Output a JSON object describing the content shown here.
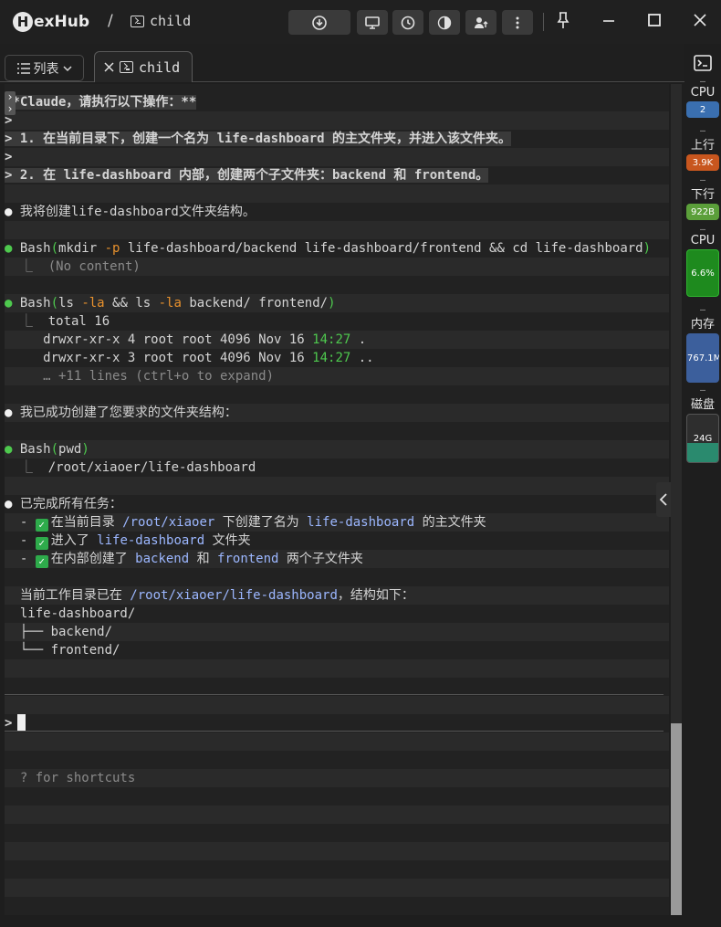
{
  "app": {
    "logo_letter": "H",
    "logo_rest": "exHub",
    "crumb_sep": "/",
    "crumb_title": "child"
  },
  "tabs": {
    "list_label": "列表",
    "child_label": "child"
  },
  "terminal": {
    "lines": [
      {
        "segs": [
          {
            "t": "**Claude，请执行以下操作：**",
            "c": "b hl"
          }
        ],
        "alt": false
      },
      {
        "segs": [
          {
            "t": ">",
            "c": "b"
          }
        ],
        "alt": true
      },
      {
        "segs": [
          {
            "t": "> 1. 在当前目录下，创建一个名为 life-dashboard 的主文件夹，并进入该文件夹。",
            "c": "b hl"
          }
        ],
        "alt": false
      },
      {
        "segs": [
          {
            "t": ">",
            "c": "b"
          }
        ],
        "alt": true
      },
      {
        "segs": [
          {
            "t": "> 2. 在 life-dashboard 内部，创建两个子文件夹：backend 和 frontend。",
            "c": "b hl"
          }
        ],
        "alt": false
      },
      {
        "segs": [],
        "alt": true
      },
      {
        "segs": [
          {
            "t": "● ",
            "c": "dot-w"
          },
          {
            "t": "我将创建life-dashboard文件夹结构。",
            "c": ""
          }
        ],
        "alt": false
      },
      {
        "segs": [],
        "alt": true
      },
      {
        "segs": [
          {
            "t": "● ",
            "c": "dot-g"
          },
          {
            "t": "Bash",
            "c": ""
          },
          {
            "t": "(",
            "c": "green"
          },
          {
            "t": "mkdir ",
            "c": ""
          },
          {
            "t": "-p",
            "c": "orange"
          },
          {
            "t": " life-dashboard/backend life-dashboard/frontend && cd life-dashboard",
            "c": ""
          },
          {
            "t": ")",
            "c": "green"
          }
        ],
        "alt": false
      },
      {
        "segs": [
          {
            "t": "  ⎿  ",
            "c": "dim"
          },
          {
            "t": "(No content)",
            "c": "dim"
          }
        ],
        "alt": true
      },
      {
        "segs": [],
        "alt": false
      },
      {
        "segs": [
          {
            "t": "● ",
            "c": "dot-g"
          },
          {
            "t": "Bash",
            "c": ""
          },
          {
            "t": "(",
            "c": "green"
          },
          {
            "t": "ls ",
            "c": ""
          },
          {
            "t": "-la",
            "c": "orange"
          },
          {
            "t": " && ls ",
            "c": ""
          },
          {
            "t": "-la",
            "c": "orange"
          },
          {
            "t": " backend/ frontend/",
            "c": ""
          },
          {
            "t": ")",
            "c": "green"
          }
        ],
        "alt": true
      },
      {
        "segs": [
          {
            "t": "  ⎿  ",
            "c": "dim"
          },
          {
            "t": "total 16",
            "c": ""
          }
        ],
        "alt": false
      },
      {
        "segs": [
          {
            "t": "     drwxr-xr-x 4 root root 4096 Nov 16 ",
            "c": ""
          },
          {
            "t": "14:27",
            "c": "green"
          },
          {
            "t": " .",
            "c": ""
          }
        ],
        "alt": true
      },
      {
        "segs": [
          {
            "t": "     drwxr-xr-x 3 root root 4096 Nov 16 ",
            "c": ""
          },
          {
            "t": "14:27",
            "c": "green"
          },
          {
            "t": " ..",
            "c": ""
          }
        ],
        "alt": false
      },
      {
        "segs": [
          {
            "t": "     … +11 lines (ctrl+o to expand)",
            "c": "dim"
          }
        ],
        "alt": true
      },
      {
        "segs": [],
        "alt": false
      },
      {
        "segs": [
          {
            "t": "● ",
            "c": "dot-w"
          },
          {
            "t": "我已成功创建了您要求的文件夹结构：",
            "c": ""
          }
        ],
        "alt": true
      },
      {
        "segs": [],
        "alt": false
      },
      {
        "segs": [
          {
            "t": "● ",
            "c": "dot-g"
          },
          {
            "t": "Bash",
            "c": ""
          },
          {
            "t": "(",
            "c": "green"
          },
          {
            "t": "pwd",
            "c": ""
          },
          {
            "t": ")",
            "c": "green"
          }
        ],
        "alt": true
      },
      {
        "segs": [
          {
            "t": "  ⎿  ",
            "c": "dim"
          },
          {
            "t": "/root/xiaoer/life-dashboard",
            "c": ""
          }
        ],
        "alt": false
      },
      {
        "segs": [],
        "alt": true
      },
      {
        "segs": [
          {
            "t": "● ",
            "c": "dot-w"
          },
          {
            "t": "已完成所有任务：",
            "c": ""
          }
        ],
        "alt": false
      },
      {
        "segs": [
          {
            "t": "  - ",
            "c": ""
          },
          {
            "t": "✓",
            "c": "check"
          },
          {
            "t": "在当前目录 ",
            "c": ""
          },
          {
            "t": "/root/xiaoer",
            "c": "path"
          },
          {
            "t": " 下创建了名为 ",
            "c": ""
          },
          {
            "t": "life-dashboard",
            "c": "path"
          },
          {
            "t": " 的主文件夹",
            "c": ""
          }
        ],
        "alt": true
      },
      {
        "segs": [
          {
            "t": "  - ",
            "c": ""
          },
          {
            "t": "✓",
            "c": "check"
          },
          {
            "t": "进入了 ",
            "c": ""
          },
          {
            "t": "life-dashboard",
            "c": "path"
          },
          {
            "t": " 文件夹",
            "c": ""
          }
        ],
        "alt": false
      },
      {
        "segs": [
          {
            "t": "  - ",
            "c": ""
          },
          {
            "t": "✓",
            "c": "check"
          },
          {
            "t": "在内部创建了 ",
            "c": ""
          },
          {
            "t": "backend",
            "c": "path"
          },
          {
            "t": " 和 ",
            "c": ""
          },
          {
            "t": "frontend",
            "c": "path"
          },
          {
            "t": " 两个子文件夹",
            "c": ""
          }
        ],
        "alt": true
      },
      {
        "segs": [],
        "alt": false
      },
      {
        "segs": [
          {
            "t": "  当前工作目录已在 ",
            "c": ""
          },
          {
            "t": "/root/xiaoer/life-dashboard",
            "c": "path"
          },
          {
            "t": "，结构如下：",
            "c": ""
          }
        ],
        "alt": true
      },
      {
        "segs": [
          {
            "t": "  life-dashboard/",
            "c": ""
          }
        ],
        "alt": false
      },
      {
        "segs": [
          {
            "t": "  ├── backend/",
            "c": ""
          }
        ],
        "alt": true
      },
      {
        "segs": [
          {
            "t": "  └── frontend/",
            "c": ""
          }
        ],
        "alt": false
      },
      {
        "segs": [],
        "alt": true
      },
      {
        "segs": [],
        "alt": false
      },
      {
        "segs": [],
        "alt": true
      },
      {
        "segs": [
          {
            "t": ">",
            "c": "b"
          },
          {
            "t": "",
            "c": "cursor"
          }
        ],
        "alt": false
      },
      {
        "segs": [],
        "alt": true
      },
      {
        "segs": [],
        "alt": false
      },
      {
        "segs": [
          {
            "t": "  ? for shortcuts",
            "c": "dim"
          }
        ],
        "alt": true
      },
      {
        "segs": [],
        "alt": false
      },
      {
        "segs": [],
        "alt": true
      },
      {
        "segs": [],
        "alt": false
      },
      {
        "segs": [],
        "alt": true
      },
      {
        "segs": [],
        "alt": false
      },
      {
        "segs": [],
        "alt": true
      },
      {
        "segs": [],
        "alt": false
      },
      {
        "segs": [],
        "alt": true
      },
      {
        "segs": [],
        "alt": false
      }
    ]
  },
  "sidebar": {
    "dash": "–",
    "cpu1_label": "CPU",
    "cpu1_value": "2",
    "up_label": "上行",
    "up_value": "3.9K",
    "down_label": "下行",
    "down_value": "922B",
    "cpu2_label": "CPU",
    "cpu2_value": "6.6%",
    "mem_label": "内存",
    "mem_value": "767.1M",
    "disk_label": "磁盘",
    "disk_value": "24G"
  },
  "colors": {
    "cpu1": "#3a6fb0",
    "up": "#c8561e",
    "down": "#5b9f3a",
    "cpu2": "#1e8a1e",
    "mem": "#3c5f9c",
    "disk": "#2a8a6e"
  }
}
